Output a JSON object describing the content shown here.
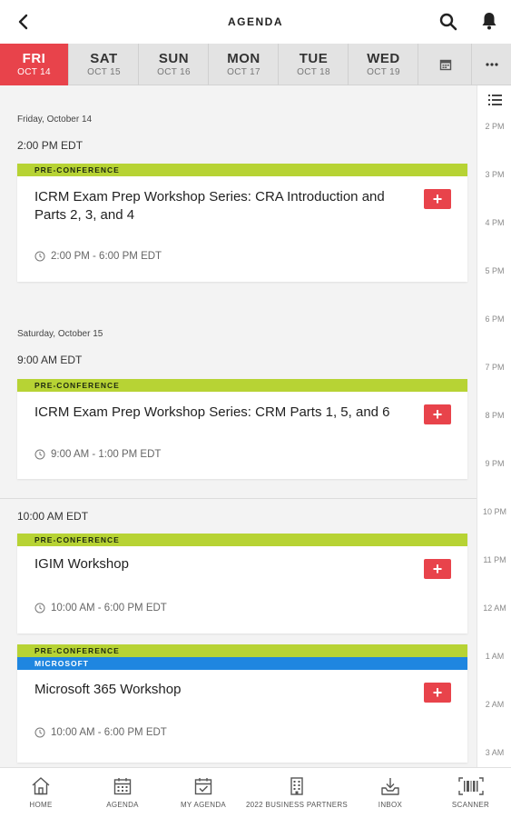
{
  "header": {
    "title": "AGENDA"
  },
  "days": [
    {
      "name": "FRI",
      "date": "OCT 14"
    },
    {
      "name": "SAT",
      "date": "OCT 15"
    },
    {
      "name": "SUN",
      "date": "OCT 16"
    },
    {
      "name": "MON",
      "date": "OCT 17"
    },
    {
      "name": "TUE",
      "date": "OCT 18"
    },
    {
      "name": "WED",
      "date": "OCT 19"
    }
  ],
  "timeline": [
    "2 PM",
    "3 PM",
    "4 PM",
    "5 PM",
    "6 PM",
    "7 PM",
    "8 PM",
    "9 PM",
    "10 PM",
    "11 PM",
    "12 AM",
    "1 AM",
    "2 AM",
    "3 AM"
  ],
  "sections": [
    {
      "day_heading": "Friday, October 14",
      "time_heading": "2:00 PM EDT",
      "sessions": [
        {
          "tags": [
            "PRE-CONFERENCE"
          ],
          "title": "ICRM Exam Prep Workshop Series: CRA Introduction and Parts 2, 3, and 4",
          "time": "2:00 PM - 6:00 PM EDT"
        }
      ]
    },
    {
      "day_heading": "Saturday, October 15",
      "time_heading": "9:00 AM EDT",
      "sessions": [
        {
          "tags": [
            "PRE-CONFERENCE"
          ],
          "title": "ICRM Exam Prep Workshop Series: CRM Parts 1, 5, and 6",
          "time": "9:00 AM - 1:00 PM EDT"
        }
      ]
    },
    {
      "time_heading": "10:00 AM EDT",
      "sessions": [
        {
          "tags": [
            "PRE-CONFERENCE"
          ],
          "title": "IGIM Workshop",
          "time": "10:00 AM - 6:00 PM EDT"
        },
        {
          "tags": [
            "PRE-CONFERENCE",
            "MICROSOFT"
          ],
          "title": "Microsoft 365 Workshop",
          "time": "10:00 AM - 6:00 PM EDT"
        }
      ]
    }
  ],
  "add_label": "+",
  "nav": [
    {
      "label": "HOME",
      "icon": "home-icon"
    },
    {
      "label": "AGENDA",
      "icon": "calendar-icon"
    },
    {
      "label": "MY AGENDA",
      "icon": "calendar-check-icon"
    },
    {
      "label": "2022 BUSINESS PARTNERS",
      "icon": "building-icon"
    },
    {
      "label": "INBOX",
      "icon": "inbox-icon"
    },
    {
      "label": "SCANNER",
      "icon": "barcode-scanner-icon"
    }
  ],
  "colors": {
    "accent": "#e8434b",
    "tag_green": "#b7d334",
    "tag_blue": "#1f86e0"
  }
}
